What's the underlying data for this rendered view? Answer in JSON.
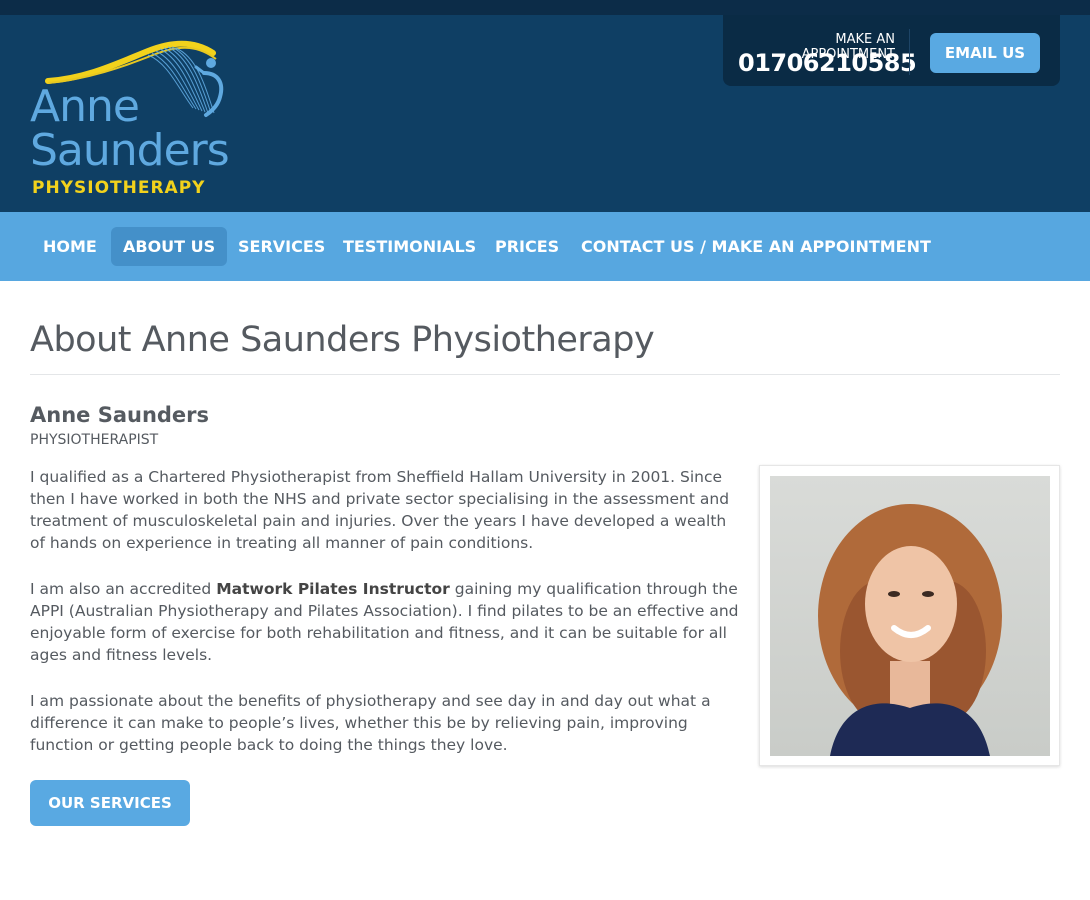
{
  "brand": {
    "line1": "Anne",
    "line2": "Saunders",
    "line3": "PHYSIOTHERAPY",
    "colors": {
      "primary_blue": "#5fa9e0",
      "accent_yellow": "#f2d21c",
      "header_dark": "#0f3f64"
    }
  },
  "appointment": {
    "label": "MAKE AN APPOINTMENT",
    "phone": "01706210585",
    "email_button": "EMAIL US"
  },
  "nav": {
    "items": [
      {
        "label": "HOME",
        "active": false
      },
      {
        "label": "ABOUT US",
        "active": true
      },
      {
        "label": "SERVICES",
        "active": false
      },
      {
        "label": "TESTIMONIALS",
        "active": false
      },
      {
        "label": "PRICES",
        "active": false
      },
      {
        "label": "CONTACT US / MAKE AN APPOINTMENT",
        "active": false
      }
    ]
  },
  "page": {
    "title": "About Anne Saunders Physiotherapy",
    "person_name": "Anne Saunders",
    "person_role": "PHYSIOTHERAPIST",
    "para1": "I qualified as a Chartered Physiotherapist from Sheffield Hallam University in 2001. Since then I have worked in both the NHS and private sector specialising in the assessment and treatment of musculoskeletal pain and injuries. Over the years I have developed a wealth of hands on experience in treating all manner of pain conditions.",
    "para2_before": "I am also an accredited ",
    "para2_bold": "Matwork Pilates Instructor",
    "para2_after": " gaining my qualification through the APPI (Australian Physiotherapy and Pilates Association). I find pilates to be an effective and enjoyable form of exercise for both rehabilitation and fitness, and it can be suitable for all ages and fitness levels.",
    "para3": "I am passionate about the benefits of physiotherapy and see day in and day out what a difference it can make to people’s lives, whether this be by relieving pain, improving function or getting people back to doing the things they love.",
    "cta_button": "OUR SERVICES"
  }
}
